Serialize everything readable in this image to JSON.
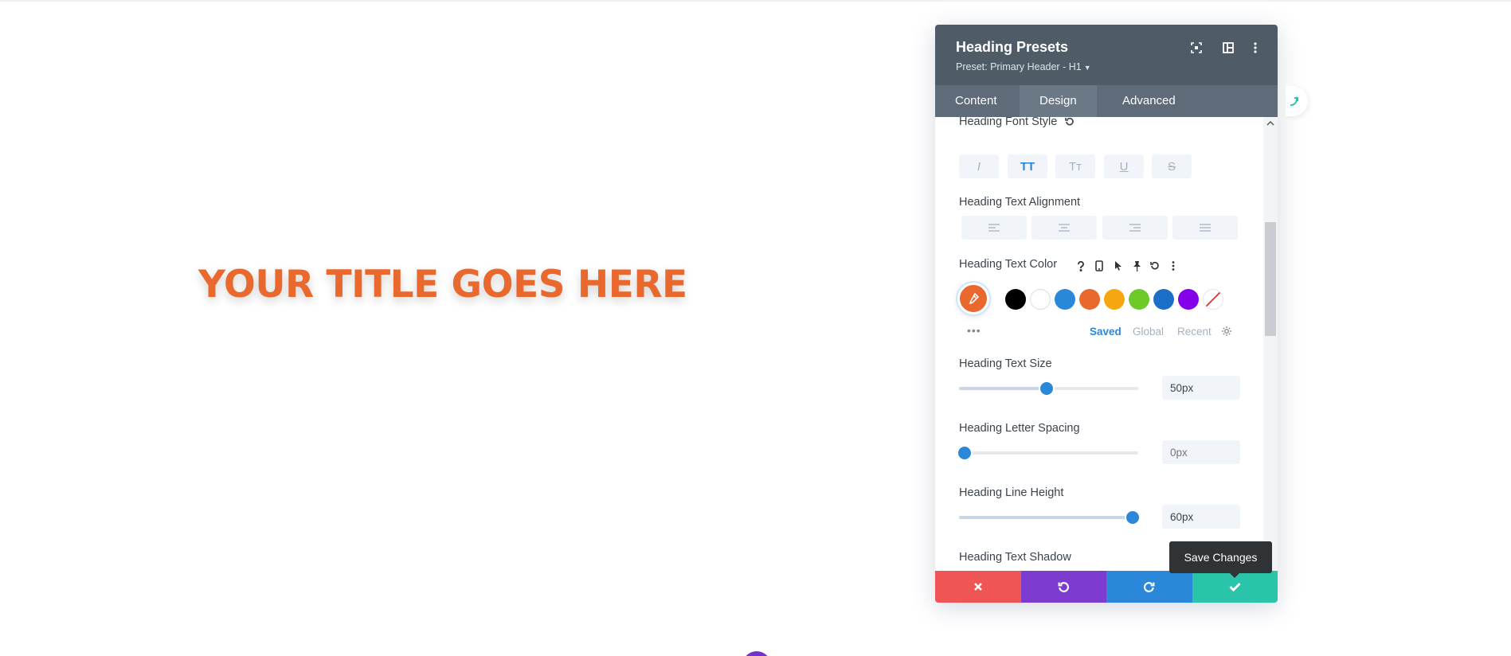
{
  "canvas": {
    "title_text": "YOUR TITLE GOES HERE",
    "title_color": "#e8682d"
  },
  "panel": {
    "title": "Heading Presets",
    "preset": "Preset: Primary Header - H1",
    "header_icons": [
      "focus-icon",
      "split-view-icon",
      "more-vertical-icon"
    ],
    "tabs": [
      {
        "label": "Content",
        "active": false
      },
      {
        "label": "Design",
        "active": true
      },
      {
        "label": "Advanced",
        "active": false
      }
    ]
  },
  "settings": {
    "font_style": {
      "label": "Heading Font Style",
      "buttons": [
        {
          "glyph": "I",
          "name": "italic",
          "active": false
        },
        {
          "glyph": "TT",
          "name": "uppercase",
          "active": true
        },
        {
          "glyph": "Tт",
          "name": "capitalize",
          "active": false
        },
        {
          "glyph": "U",
          "name": "underline",
          "active": false
        },
        {
          "glyph": "S",
          "name": "strikethrough",
          "active": false
        }
      ]
    },
    "text_alignment": {
      "label": "Heading Text Alignment",
      "buttons": [
        "align-left",
        "align-center",
        "align-right",
        "align-justify"
      ]
    },
    "text_color": {
      "label": "Heading Text Color",
      "current": "#e8682d",
      "swatches": [
        "#000000",
        "#ffffff",
        "#2b87da",
        "#e8682d",
        "#f5a711",
        "#6ec92b",
        "#1b6fc7",
        "#8300e9"
      ],
      "tabs": [
        {
          "label": "Saved",
          "active": true
        },
        {
          "label": "Global",
          "active": false
        },
        {
          "label": "Recent",
          "active": false
        }
      ]
    },
    "text_size": {
      "label": "Heading Text Size",
      "value": "50px",
      "fraction": 0.49
    },
    "letter_spacing": {
      "label": "Heading Letter Spacing",
      "value": "",
      "placeholder": "0px",
      "fraction": 0.03
    },
    "line_height": {
      "label": "Heading Line Height",
      "value": "60px",
      "fraction": 0.97
    },
    "text_shadow": {
      "label": "Heading Text Shadow"
    }
  },
  "footer": {
    "colors": [
      "#ef5555",
      "#7e3bd0",
      "#2b87da",
      "#29c4a9"
    ],
    "tooltip": "Save Changes"
  }
}
